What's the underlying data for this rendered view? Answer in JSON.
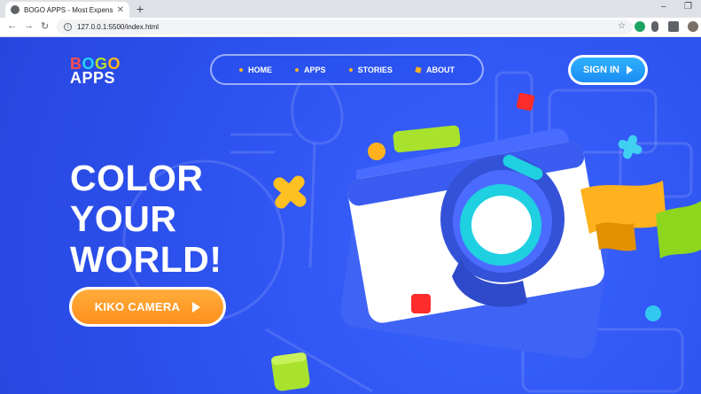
{
  "browser": {
    "tab_title": "BOGO APPS - Most Expensive A",
    "url": "127.0.0.1:5500/index.html"
  },
  "logo": {
    "line1": [
      "B",
      "O",
      "G",
      "O"
    ],
    "line2": "APPS",
    "line1_colors": [
      "#ff4d4d",
      "#21d4fd",
      "#b6e12b",
      "#ffb21e"
    ]
  },
  "nav": {
    "items": [
      {
        "label": "HOME"
      },
      {
        "label": "APPS"
      },
      {
        "label": "STORIES"
      },
      {
        "label": "ABOUT"
      }
    ]
  },
  "signin": {
    "label": "SIGN IN"
  },
  "hero": {
    "headline": [
      "COLOR",
      "YOUR",
      "WORLD!"
    ],
    "cta_label": "KIKO CAMERA"
  },
  "colors": {
    "background": "#2f55f0",
    "accent_orange": "#ff9a26",
    "accent_blue": "#1b8cf3",
    "accent_green": "#a9e22d",
    "accent_yellow": "#ffb21e"
  }
}
